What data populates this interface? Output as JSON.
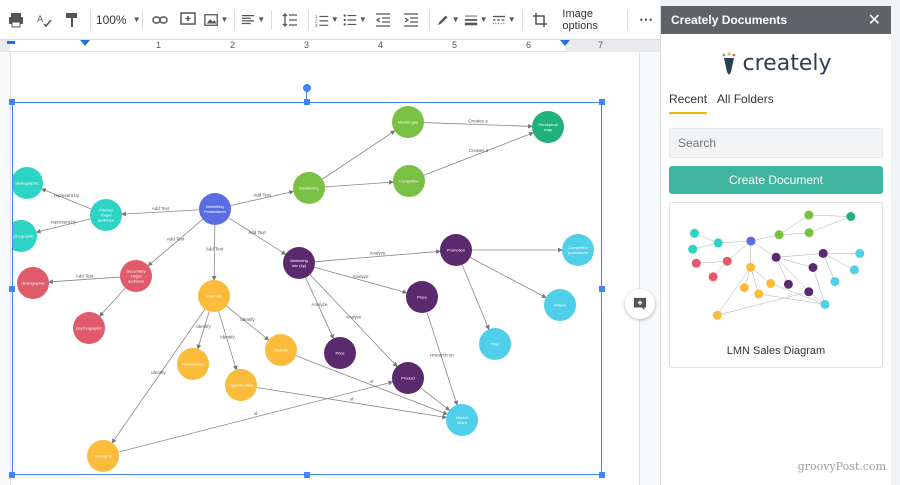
{
  "toolbar": {
    "zoom": "100%",
    "image_options": "Image options",
    "more": "⋯"
  },
  "ruler": {
    "numbers": [
      "1",
      "2",
      "3",
      "4",
      "5",
      "6",
      "7"
    ]
  },
  "sidebar": {
    "title": "Creately Documents",
    "close": "✕",
    "logo_text": "creately",
    "tabs": [
      "Recent",
      "All Folders"
    ],
    "search_placeholder": "Search",
    "create_button": "Create Document",
    "recent_doc_title": "LMN Sales Diagram"
  },
  "watermark": "groovyPost.com",
  "colors": {
    "accent": "#3fb49f",
    "selection": "#4285f4",
    "green": "#7ac143",
    "teal_green": "#21b27b",
    "blue_purple": "#5b6ee1",
    "cyan": "#2dd4c4",
    "red": "#e05a6a",
    "orange": "#fbbc3b",
    "purple": "#5b2a6e",
    "light_blue": "#4fcfea"
  },
  "diagram": {
    "nodes": [
      {
        "label": "Marketing Postmasters",
        "color": "#5b6ee1"
      },
      {
        "label": "Positioning",
        "color": "#7ac143"
      },
      {
        "label": "Market gap",
        "color": "#7ac143"
      },
      {
        "label": "Competitor",
        "color": "#7ac143"
      },
      {
        "label": "Perceptual map",
        "color": "#21b27b"
      },
      {
        "label": "Primary Target audience",
        "color": "#2dd4c4"
      },
      {
        "label": "demographic",
        "color": "#2dd4c4"
      },
      {
        "label": "psychographic",
        "color": "#2dd4c4"
      },
      {
        "label": "Secondary Target audience",
        "color": "#e05a6a"
      },
      {
        "label": "demographic",
        "color": "#e05a6a"
      },
      {
        "label": "psychographic",
        "color": "#e05a6a"
      },
      {
        "label": "Internals",
        "color": "#fbbc3b"
      },
      {
        "label": "Weaknesses",
        "color": "#fbbc3b"
      },
      {
        "label": "Opportunities",
        "color": "#fbbc3b"
      },
      {
        "label": "Threats",
        "color": "#fbbc3b"
      },
      {
        "label": "Strengths",
        "color": "#fbbc3b"
      },
      {
        "label": "Marketing mix (4p)",
        "color": "#5b2a6e"
      },
      {
        "label": "Promotion",
        "color": "#5b2a6e"
      },
      {
        "label": "Place",
        "color": "#5b2a6e"
      },
      {
        "label": "Price",
        "color": "#5b2a6e"
      },
      {
        "label": "Product",
        "color": "#5b2a6e"
      },
      {
        "label": "Competitor promotions",
        "color": "#4fcfea"
      },
      {
        "label": "Where",
        "color": "#4fcfea"
      },
      {
        "label": "Time",
        "color": "#4fcfea"
      },
      {
        "label": "Market share",
        "color": "#4fcfea"
      }
    ],
    "edge_labels": [
      "Add Text",
      "Add Text",
      "Add Text",
      "Add Text",
      "Add Text",
      "Add Text",
      "Creates a",
      "Creates a",
      "represent by",
      "represent by",
      "Identify",
      "Identify",
      "Identify",
      "Identify",
      "Analyze",
      "Analyze",
      "Analyze",
      "Analyze",
      "research on",
      "of",
      "of",
      "of"
    ]
  }
}
